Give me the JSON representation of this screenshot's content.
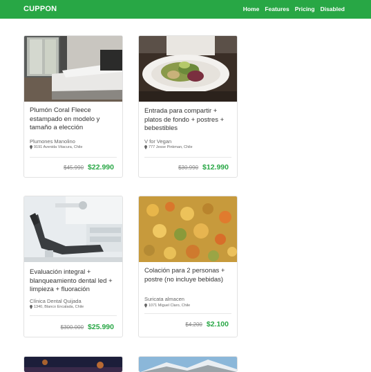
{
  "nav": {
    "brand": "CUPPON",
    "links": [
      "Home",
      "Features",
      "Pricing",
      "Disabled"
    ]
  },
  "cards": [
    {
      "title": "Plumón Coral Fleece estampado en modelo y tamaño a elección",
      "merchant": "Plumones Manolino",
      "address": "9191 Avenida Vitacura, Chile",
      "old_price": "$45.990",
      "new_price": "$22.990",
      "image": "bedroom-photo"
    },
    {
      "title": "Entrada para compartir + platos de fondo + postres + bebestibles",
      "merchant": "V for Vegan",
      "address": "777 Jesse Pinkman, Chile",
      "old_price": "$30.990",
      "new_price": "$12.990",
      "image": "salad-plate-photo"
    },
    {
      "title": "Evaluación integral + blanqueamiento dental led + limpieza + fluoración",
      "merchant": "Clínica Dental Quijada",
      "address": "1340, Blanco Encalada, Chile",
      "old_price": "$300.000",
      "new_price": "$25.990",
      "image": "dental-chair-photo"
    },
    {
      "title": "Colación para 2 personas + postre (no incluye bebidas)",
      "merchant": "Suricata almacen",
      "address": "1071 Miguel Claro, Chile",
      "old_price": "$4.200",
      "new_price": "$2.100",
      "image": "curry-dish-photo"
    }
  ],
  "colors": {
    "brand_green": "#28a745"
  }
}
